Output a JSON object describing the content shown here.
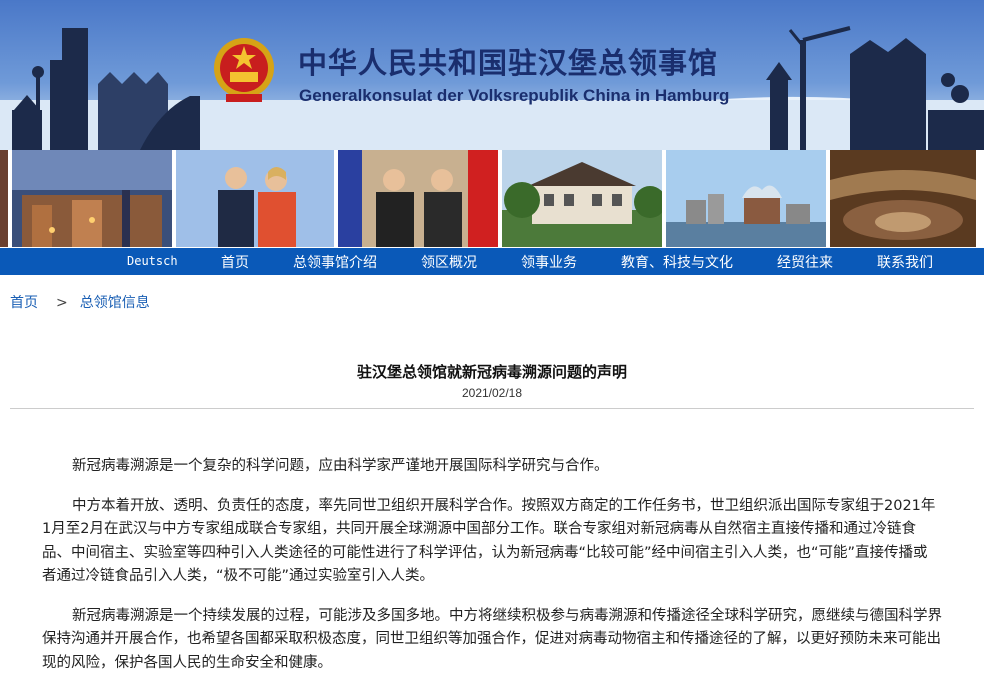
{
  "header": {
    "title_cn": "中华人民共和国驻汉堡总领事馆",
    "title_de": "Generalkonsulat der Volksrepublik China in Hamburg",
    "colors": {
      "banner_blue": "#4a78c8",
      "title": "#1a2e6e",
      "nav": "#0a59b8"
    }
  },
  "photos": [
    {
      "name": "hamburg-night-city"
    },
    {
      "name": "leaders-handshake-1"
    },
    {
      "name": "leaders-handshake-2"
    },
    {
      "name": "consulate-building"
    },
    {
      "name": "elbphilharmonie"
    },
    {
      "name": "concert-hall"
    }
  ],
  "nav": {
    "items": [
      "Deutsch",
      "首页",
      "总领事馆介绍",
      "领区概况",
      "领事业务",
      "教育、科技与文化",
      "经贸往来",
      "联系我们"
    ]
  },
  "breadcrumb": {
    "home": "首页",
    "separator": ">",
    "section": "总领馆信息"
  },
  "article": {
    "title": "驻汉堡总领馆就新冠病毒溯源问题的声明",
    "date": "2021/02/18",
    "paragraphs": [
      "新冠病毒溯源是一个复杂的科学问题，应由科学家严谨地开展国际科学研究与合作。",
      "中方本着开放、透明、负责任的态度，率先同世卫组织开展科学合作。按照双方商定的工作任务书，世卫组织派出国际专家组于2021年1月至2月在武汉与中方专家组成联合专家组，共同开展全球溯源中国部分工作。联合专家组对新冠病毒从自然宿主直接传播和通过冷链食品、中间宿主、实验室等四种引入人类途径的可能性进行了科学评估，认为新冠病毒“比较可能”经中间宿主引入人类，也“可能”直接传播或者通过冷链食品引入人类，“极不可能”通过实验室引入人类。",
      "新冠病毒溯源是一个持续发展的过程，可能涉及多国多地。中方将继续积极参与病毒溯源和传播途径全球科学研究，愿继续与德国科学界保持沟通并开展合作，也希望各国都采取积极态度，同世卫组织等加强合作，促进对病毒动物宿主和传播途径的了解，以更好预防未来可能出现的风险，保护各国人民的生命安全和健康。"
    ]
  }
}
